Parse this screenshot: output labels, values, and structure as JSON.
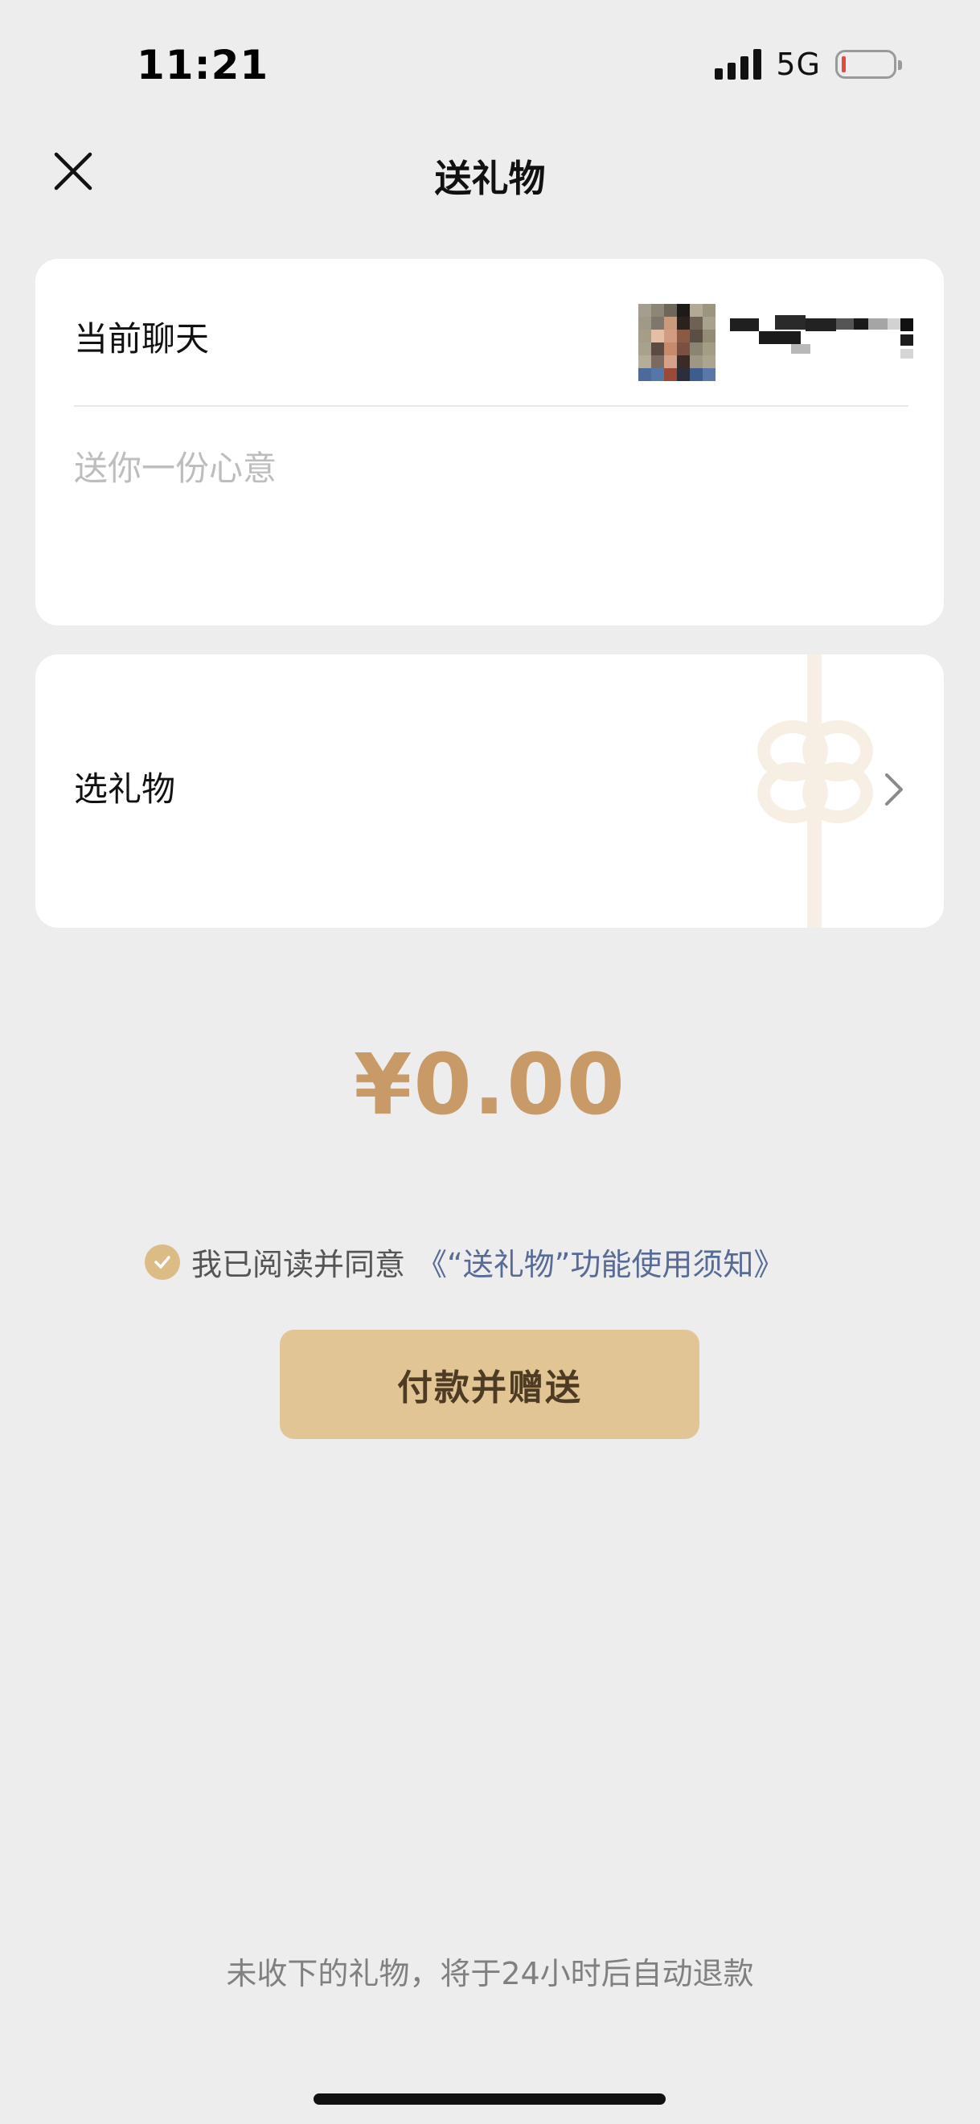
{
  "status_bar": {
    "time": "11:21",
    "network": "5G",
    "battery_level_percent": 8
  },
  "nav": {
    "title": "送礼物",
    "close_icon": "close-icon"
  },
  "chat_card": {
    "label": "当前聊天",
    "avatar": "pixelated-avatar",
    "contact_name": "",
    "message_placeholder": "送你一份心意",
    "message_value": ""
  },
  "gift_card": {
    "label": "选礼物",
    "decoration_icon": "ribbon-bow-icon",
    "chevron_icon": "chevron-right-icon"
  },
  "amount": "¥0.00",
  "agreement": {
    "checked": true,
    "text": "我已阅读并同意",
    "link": "《“送礼物”功能使用须知》"
  },
  "pay_button": {
    "label": "付款并赠送"
  },
  "footer": {
    "note": "未收下的礼物，将于24小时后自动退款"
  },
  "colors": {
    "page_background": "#ededed",
    "card_background": "#ffffff",
    "amount": "#c89a67",
    "button_background": "#e1c595",
    "button_text": "#4d3b23",
    "link": "#576b95",
    "check": "#dcbc85"
  }
}
